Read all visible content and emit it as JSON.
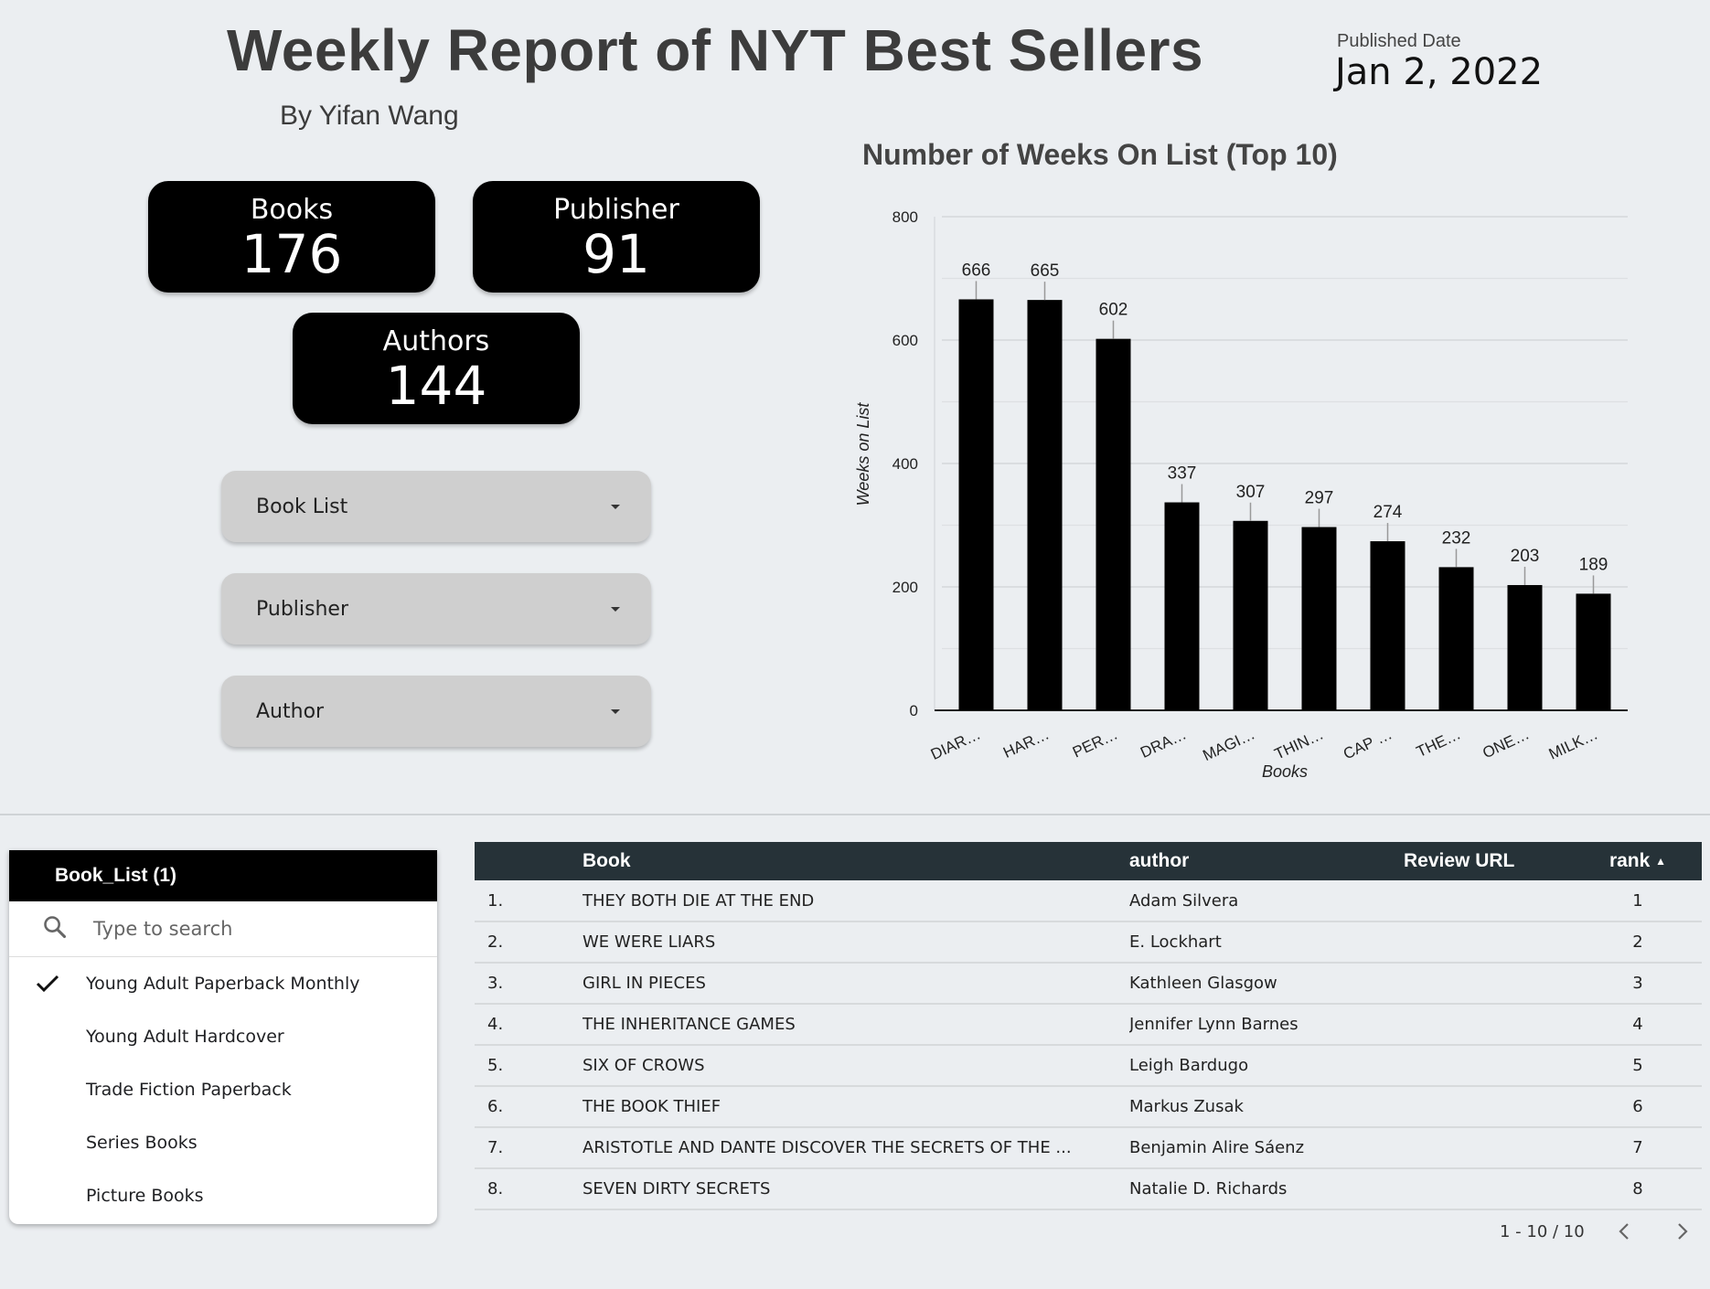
{
  "header": {
    "title": "Weekly Report of NYT Best Sellers",
    "subtitle": "By Yifan Wang",
    "published_label": "Published Date",
    "published_date": "Jan 2, 2022"
  },
  "kpis": [
    {
      "label": "Books",
      "value": "176"
    },
    {
      "label": "Publisher",
      "value": "91"
    },
    {
      "label": "Authors",
      "value": "144"
    }
  ],
  "dropdowns": [
    {
      "label": "Book List"
    },
    {
      "label": "Publisher"
    },
    {
      "label": "Author"
    }
  ],
  "filter": {
    "title": "Book_List (1)",
    "search_placeholder": "Type to search",
    "items": [
      {
        "label": "Young Adult Paperback Monthly",
        "checked": true
      },
      {
        "label": "Young Adult Hardcover",
        "checked": false
      },
      {
        "label": "Trade Fiction Paperback",
        "checked": false
      },
      {
        "label": "Series Books",
        "checked": false
      },
      {
        "label": "Picture Books",
        "checked": false
      }
    ]
  },
  "table": {
    "columns": [
      "",
      "Book",
      "author",
      "Review URL",
      "rank"
    ],
    "sort_indicator": "▲",
    "rows": [
      {
        "idx": "1.",
        "book": "THEY BOTH DIE AT THE END",
        "author": "Adam Silvera",
        "url": "",
        "rank": "1"
      },
      {
        "idx": "2.",
        "book": "WE WERE LIARS",
        "author": "E. Lockhart",
        "url": "",
        "rank": "2"
      },
      {
        "idx": "3.",
        "book": "GIRL IN PIECES",
        "author": "Kathleen Glasgow",
        "url": "",
        "rank": "3"
      },
      {
        "idx": "4.",
        "book": "THE INHERITANCE GAMES",
        "author": "Jennifer Lynn Barnes",
        "url": "",
        "rank": "4"
      },
      {
        "idx": "5.",
        "book": "SIX OF CROWS",
        "author": "Leigh Bardugo",
        "url": "",
        "rank": "5"
      },
      {
        "idx": "6.",
        "book": "THE BOOK THIEF",
        "author": "Markus Zusak",
        "url": "",
        "rank": "6"
      },
      {
        "idx": "7.",
        "book": "ARISTOTLE AND DANTE DISCOVER THE SECRETS OF THE ...",
        "author": "Benjamin Alire Sáenz",
        "url": "",
        "rank": "7"
      },
      {
        "idx": "8.",
        "book": "SEVEN DIRTY SECRETS",
        "author": "Natalie D. Richards",
        "url": "",
        "rank": "8"
      }
    ],
    "pagination": "1 - 10 / 10"
  },
  "chart_data": {
    "type": "bar",
    "title": "Number of Weeks On List (Top 10)",
    "xlabel": "Books",
    "ylabel": "Weeks on List",
    "categories": [
      "DIAR…",
      "HAR…",
      "PER…",
      "DRA…",
      "MAGI…",
      "THIN…",
      "CAP …",
      "THE…",
      "ONE…",
      "MILK…"
    ],
    "values": [
      666,
      665,
      602,
      337,
      307,
      297,
      274,
      232,
      203,
      189
    ],
    "yticks": [
      0,
      200,
      400,
      600,
      800
    ],
    "ylim": [
      0,
      800
    ],
    "grid": true,
    "bar_color": "#000000"
  }
}
